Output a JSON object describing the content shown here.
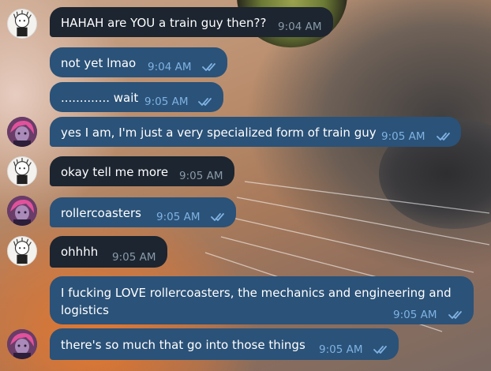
{
  "messages": [
    {
      "from": "friend",
      "text": "HAHAH are YOU a train guy then??",
      "time": "9:04 AM"
    },
    {
      "from": "me",
      "text": "not yet lmao",
      "time": "9:04 AM",
      "status": "read"
    },
    {
      "from": "me",
      "text": "............. wait",
      "time": "9:05 AM",
      "status": "read"
    },
    {
      "from": "me",
      "text": "yes I am, I'm just a very specialized form of train guy",
      "time": "9:05 AM",
      "status": "read"
    },
    {
      "from": "friend",
      "text": "okay tell me more",
      "time": "9:05 AM"
    },
    {
      "from": "me",
      "text": "rollercoasters",
      "time": "9:05 AM",
      "status": "read"
    },
    {
      "from": "friend",
      "text": "ohhhh",
      "time": "9:05 AM"
    },
    {
      "from": "me",
      "text_lines": [
        "I fucking LOVE rollercoasters, the mechanics and engineering and",
        "logistics"
      ],
      "time": "9:05 AM",
      "status": "read"
    },
    {
      "from": "me",
      "text": "there's so much that go into those things",
      "time": "9:05 AM",
      "status": "read"
    }
  ],
  "colors": {
    "incoming_bubble": "#1c2530",
    "outgoing_bubble": "#2b5278",
    "outgoing_time": "#7fb2e3",
    "incoming_time": "#8a9aa9"
  },
  "icons": {
    "read_receipt": "double-check-icon",
    "friend_avatar": "sketch-character-avatar",
    "my_avatar": "pink-hair-character-avatar"
  }
}
